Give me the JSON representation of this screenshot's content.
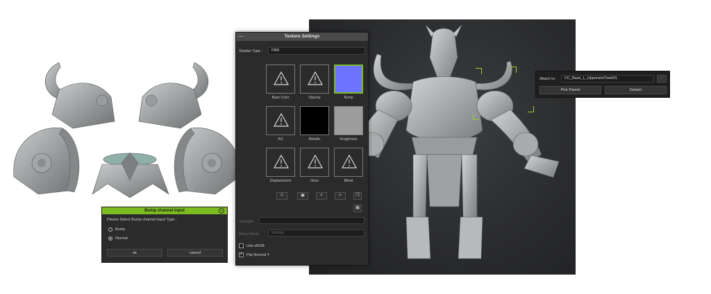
{
  "texture_panel": {
    "title": "Texture Settings",
    "shader_type_label": "Shader Type :",
    "shader_type_value": "PBR",
    "slots": [
      {
        "label": "Base Color"
      },
      {
        "label": "Opacity"
      },
      {
        "label": "Bump"
      },
      {
        "label": "AO"
      },
      {
        "label": "Metallic"
      },
      {
        "label": "Roughness"
      },
      {
        "label": "Displacement"
      },
      {
        "label": "Glow"
      },
      {
        "label": "Blend"
      }
    ],
    "strength_label": "Strength",
    "blend_mode_label": "Blend Mode",
    "blend_mode_value": "Multiply",
    "use_srgb_label": "Use sRGB",
    "flip_normal_label": "Flip Normal Y"
  },
  "bump_dialog": {
    "title": "Bump channel Input",
    "prompt": "Please Select Bump channel Input Type :",
    "option_bump": "Bump",
    "option_normal": "Normal",
    "ok_label": "ok",
    "cancel_label": "cancel"
  },
  "attach_panel": {
    "attach_label": "Attach to:",
    "attach_value": "CC_Base_L_UpperarmTwist01",
    "browse_label": "...",
    "pick_parent_label": "Pick Parent",
    "detach_label": "Detach"
  },
  "colors": {
    "accent_green": "#7cbc1f",
    "bump_swatch": "#6e74ff",
    "panel_bg": "#2b2b2b"
  }
}
